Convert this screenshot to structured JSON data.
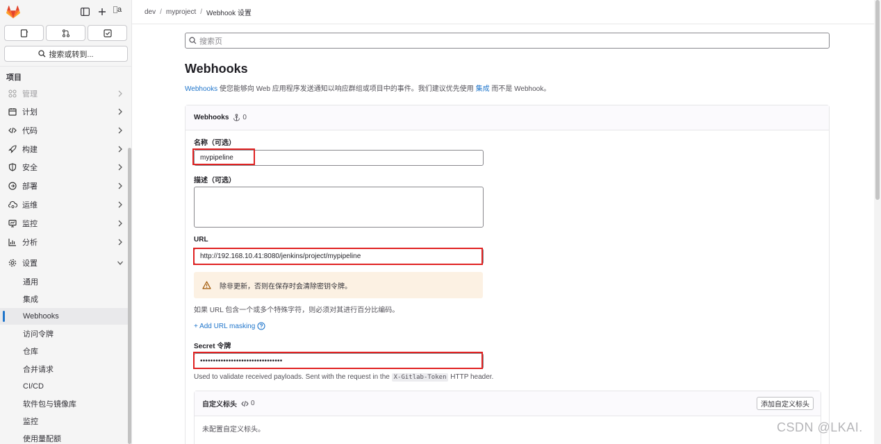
{
  "sidebar": {
    "avatar_alt": "a",
    "search_label": "搜索或转到...",
    "section_title": "项目",
    "items": [
      {
        "label": "管理",
        "icon": "apps-icon"
      },
      {
        "label": "计划",
        "icon": "calendar-icon"
      },
      {
        "label": "代码",
        "icon": "code-icon"
      },
      {
        "label": "构建",
        "icon": "rocket-icon"
      },
      {
        "label": "安全",
        "icon": "shield-icon"
      },
      {
        "label": "部署",
        "icon": "deploy-icon"
      },
      {
        "label": "运维",
        "icon": "cloud-gear-icon"
      },
      {
        "label": "监控",
        "icon": "monitor-icon"
      },
      {
        "label": "分析",
        "icon": "chart-icon"
      },
      {
        "label": "设置",
        "icon": "gear-icon"
      }
    ],
    "settings_sub": [
      "通用",
      "集成",
      "Webhooks",
      "访问令牌",
      "仓库",
      "合并请求",
      "CI/CD",
      "软件包与镜像库",
      "监控",
      "使用量配额"
    ],
    "active_sub": "Webhooks"
  },
  "breadcrumb": [
    "dev",
    "myproject",
    "Webhook 设置"
  ],
  "search": {
    "placeholder": "搜索页"
  },
  "page": {
    "title": "Webhooks",
    "desc_link": "Webhooks",
    "desc_text": " 使您能够向 Web 应用程序发送通知以响应群组或项目中的事件。我们建议优先使用 ",
    "desc_link2": "集成",
    "desc_tail": " 而不是 Webhook。"
  },
  "card": {
    "title": "Webhooks",
    "count": "0",
    "name_label": "名称（可选）",
    "name_value": "mypipeline",
    "desc_label": "描述（可选）",
    "desc_value": "",
    "url_label": "URL",
    "url_value": "http://192.168.10.41:8080/jenkins/project/mypipeline",
    "alert_text": "除非更新，否则在保存时会清除密钥令牌。",
    "url_help": "如果 URL 包含一个或多个特殊字符，则必须对其进行百分比编码。",
    "masking_link": "+ Add URL masking",
    "secret_label": "Secret 令牌",
    "secret_value": "••••••••••••••••••••••••••••••••",
    "secret_help_pre": "Used to validate received payloads. Sent with the request in the ",
    "secret_help_code": "X-Gitlab-Token",
    "secret_help_post": " HTTP header.",
    "custom_headers_title": "自定义标头",
    "custom_headers_count": "0",
    "add_header_button": "添加自定义标头",
    "no_headers": "未配置自定义标头。"
  },
  "watermark": "CSDN @LKAI.",
  "colors": {
    "accent": "#1f75cb",
    "highlight": "#e02020",
    "alert_bg": "#fcf1e3",
    "logo": "#e24329"
  }
}
